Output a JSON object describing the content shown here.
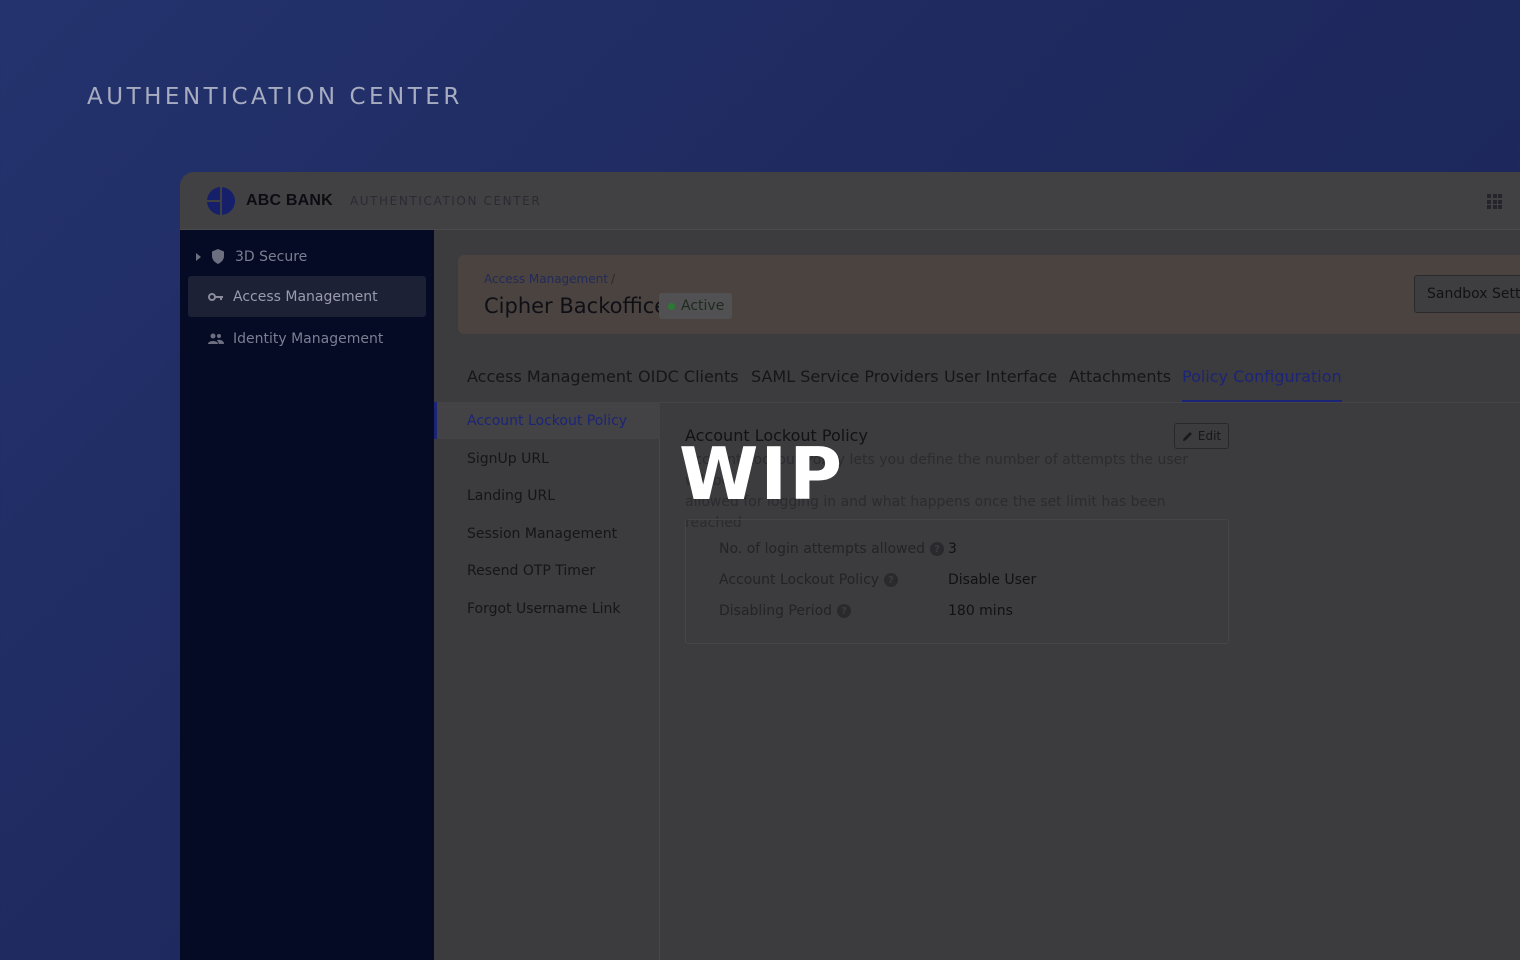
{
  "hero": {
    "title": "AUTHENTICATION CENTER"
  },
  "topbar": {
    "brand": "ABC BANK",
    "brand_sub": "AUTHENTICATION CENTER"
  },
  "sidebar": {
    "items": [
      {
        "label": "3D Secure",
        "icon": "shield-icon"
      },
      {
        "label": "Access Management",
        "icon": "key-icon"
      },
      {
        "label": "Identity Management",
        "icon": "users-icon"
      }
    ]
  },
  "header": {
    "breadcrumb": "Access Management",
    "breadcrumb_sep": "/",
    "title": "Cipher Backoffice",
    "status": "Active",
    "sandbox_label": "Sandbox Settings"
  },
  "tabs": [
    "Access Management",
    "OIDC Clients",
    "SAML Service Providers",
    "User Interface",
    "Attachments",
    "Policy Configuration"
  ],
  "subnav": [
    "Account Lockout Policy",
    "SignUp URL",
    "Landing URL",
    "Session Management",
    "Resend OTP Timer",
    "Forgot Username Link"
  ],
  "policy": {
    "title": "Account Lockout Policy",
    "edit_label": "Edit",
    "desc_line1": "Account Lockout Policy lets you define the number of attempts the user will be",
    "desc_line2": "allowed for logging in and what happens once the set limit has been reached",
    "overlay": "WIP",
    "rows": [
      {
        "label": "No. of login attempts allowed",
        "value": "3"
      },
      {
        "label": "Account Lockout Policy",
        "value": "Disable User"
      },
      {
        "label": "Disabling Period",
        "value": "180 mins"
      }
    ]
  },
  "colors": {
    "accent": "#1c2477",
    "sidebar_bg": "#050a25",
    "page_bg": "#24336e",
    "status_dot": "#2a7a32"
  }
}
